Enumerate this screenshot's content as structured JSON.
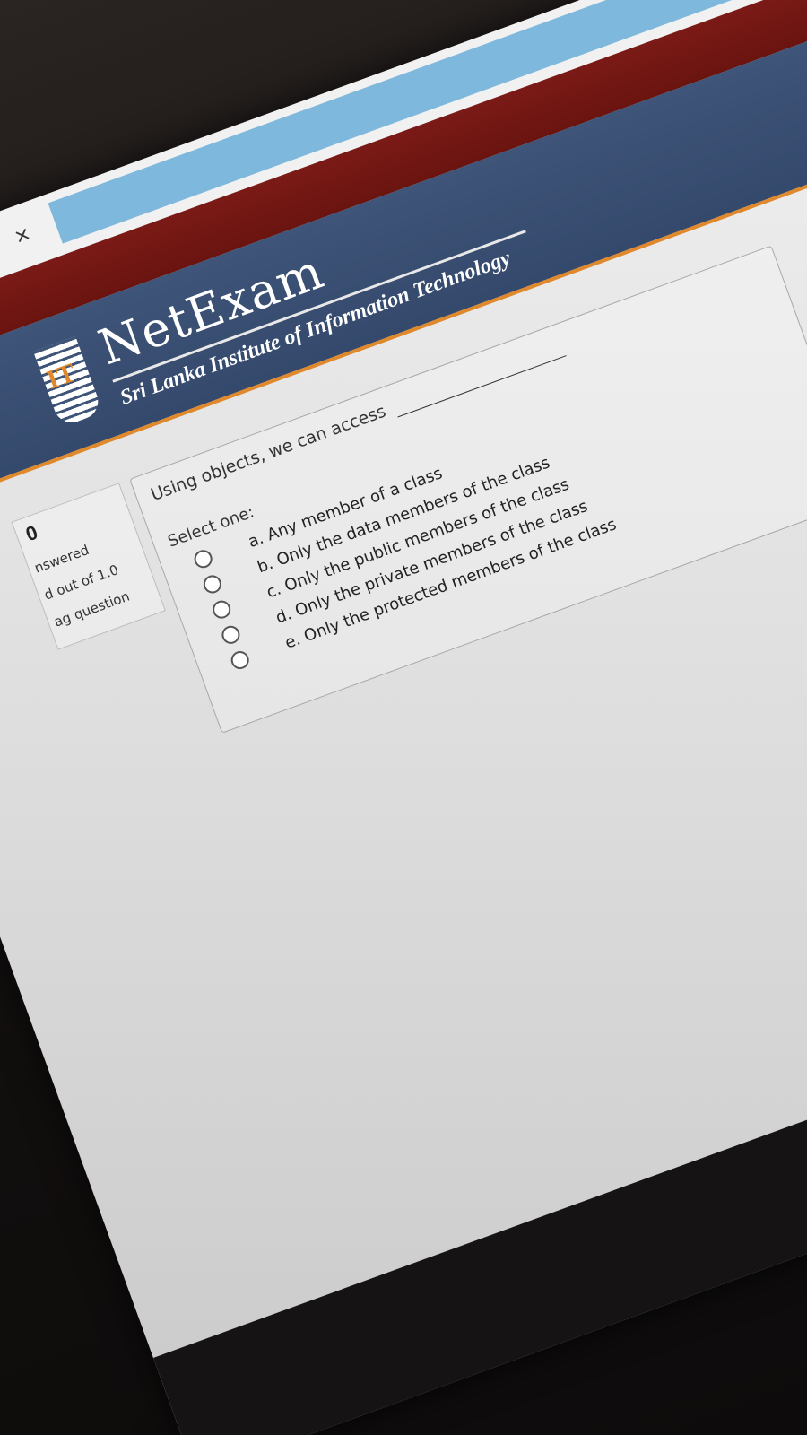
{
  "browser": {
    "close_glyph": "×",
    "info_glyph": "i",
    "page_glyph": "+"
  },
  "header": {
    "logo_text": "IT",
    "title": "NetExam",
    "subtitle": "Sri Lanka Institute of Information Technology",
    "colors": {
      "red_band": "#6a1410",
      "blue_band": "#3e5478",
      "accent": "#e0892c",
      "address_bar": "#7fb8dd"
    }
  },
  "question_info": {
    "number": "0",
    "status": "nswered",
    "marks": "d out of 1.0",
    "flag": "ag question"
  },
  "question": {
    "text": "Using objects, we can access",
    "prompt": "Select one:",
    "options": [
      {
        "label": "a. Any member of a class"
      },
      {
        "label": "b. Only the data members of the class"
      },
      {
        "label": "c. Only the public members of the class"
      },
      {
        "label": "d. Only the private members of the class"
      },
      {
        "label": "e. Only the protected members of the class"
      }
    ]
  }
}
